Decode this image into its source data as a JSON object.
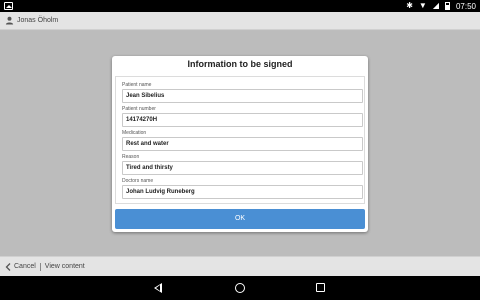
{
  "status_bar": {
    "time": "07:50",
    "icons": [
      "gallery-icon",
      "bluetooth-icon",
      "wifi-icon",
      "signal-icon",
      "battery-icon"
    ]
  },
  "header": {
    "user_name": "Jonas Öholm"
  },
  "dialog": {
    "title": "Information to be signed",
    "fields": [
      {
        "label": "Patient name",
        "value": "Jean Sibelius"
      },
      {
        "label": "Patient number",
        "value": "14174270H"
      },
      {
        "label": "Medication",
        "value": "Rest and water"
      },
      {
        "label": "Reason",
        "value": "Tired and thirsty"
      },
      {
        "label": "Doctors name",
        "value": "Johan Ludvig Runeberg"
      }
    ],
    "ok_label": "OK"
  },
  "footer": {
    "cancel_label": "Cancel",
    "view_content_label": "View content"
  },
  "colors": {
    "accent": "#4a8fd4",
    "background": "#bcbcbc",
    "bar": "#e4e4e4"
  }
}
